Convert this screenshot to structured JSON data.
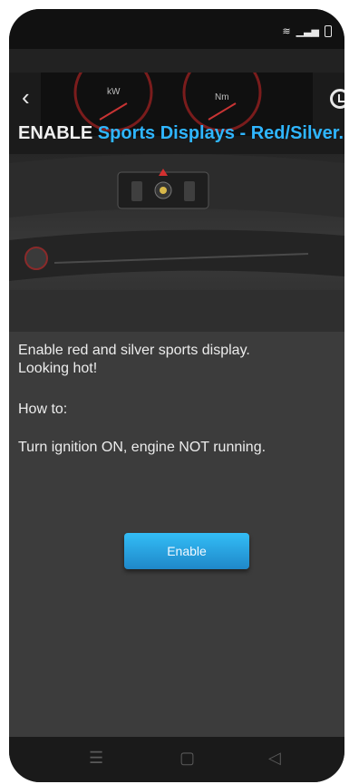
{
  "header": {
    "title_prefix": "ENABLE",
    "title_highlight": "Sports Displays - Red/Silver.",
    "back_icon": "‹"
  },
  "content": {
    "line1": "Enable red and silver sports display.",
    "line2": "Looking hot!",
    "howto_label": "How to:",
    "instruction": "Turn ignition ON, engine NOT running."
  },
  "actions": {
    "enable_label": "Enable"
  },
  "navigation": {
    "menu_glyph": "☰",
    "home_glyph": "▢",
    "back_glyph": "◁"
  },
  "hero_gauges": {
    "left_unit": "kW",
    "right_unit": "Nm"
  },
  "colors": {
    "accent": "#2fb6ff",
    "background": "#3c3c3c"
  }
}
